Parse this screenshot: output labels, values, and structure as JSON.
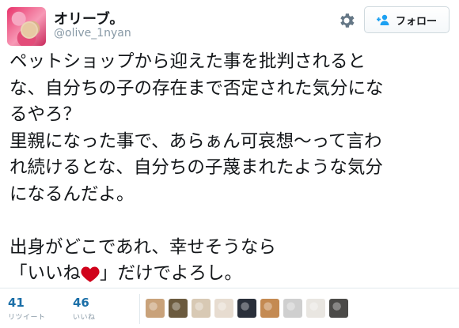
{
  "author": {
    "display_name": "オリーブ。",
    "handle": "@olive_1nyan",
    "avatar_icon": "profile-photo"
  },
  "actions": {
    "settings_icon": "gear-icon",
    "follow_icon": "person-plus-icon",
    "follow_label": "フォロー"
  },
  "tweet": {
    "lines_before_heart": "ペットショップから迎えた事を批判されると\nな、自分ちの子の存在まで否定された気分にな\nるやろ？\n里親になった事で、あらぁん可哀想〜って言わ\nれ続けるとな、自分ちの子蔑まれたような気分\nになるんだよ。\n\n出身がどこであれ、幸せそうなら\n「いいね",
    "heart_icon": "red-heart",
    "text_after_heart": "」だけでよろし。"
  },
  "stats": {
    "retweets_count": "41",
    "retweets_label": "リツイート",
    "likes_count": "46",
    "likes_label": "いいね"
  },
  "likers": [
    {
      "name": "liker-avatar-1",
      "color": "#c9a27a"
    },
    {
      "name": "liker-avatar-2",
      "color": "#6b5a3e"
    },
    {
      "name": "liker-avatar-3",
      "color": "#d8c9b4"
    },
    {
      "name": "liker-avatar-4",
      "color": "#e7dcd0"
    },
    {
      "name": "liker-avatar-5",
      "color": "#2a2f3a"
    },
    {
      "name": "liker-avatar-6",
      "color": "#c48a52"
    },
    {
      "name": "liker-avatar-7",
      "color": "#cfcfcf"
    },
    {
      "name": "liker-avatar-8",
      "color": "#e9e6e1"
    },
    {
      "name": "liker-avatar-9",
      "color": "#4b4a48"
    }
  ],
  "colors": {
    "stat_number": "#1b6fa8",
    "muted": "#8899a6",
    "heart": "#d0021b"
  }
}
